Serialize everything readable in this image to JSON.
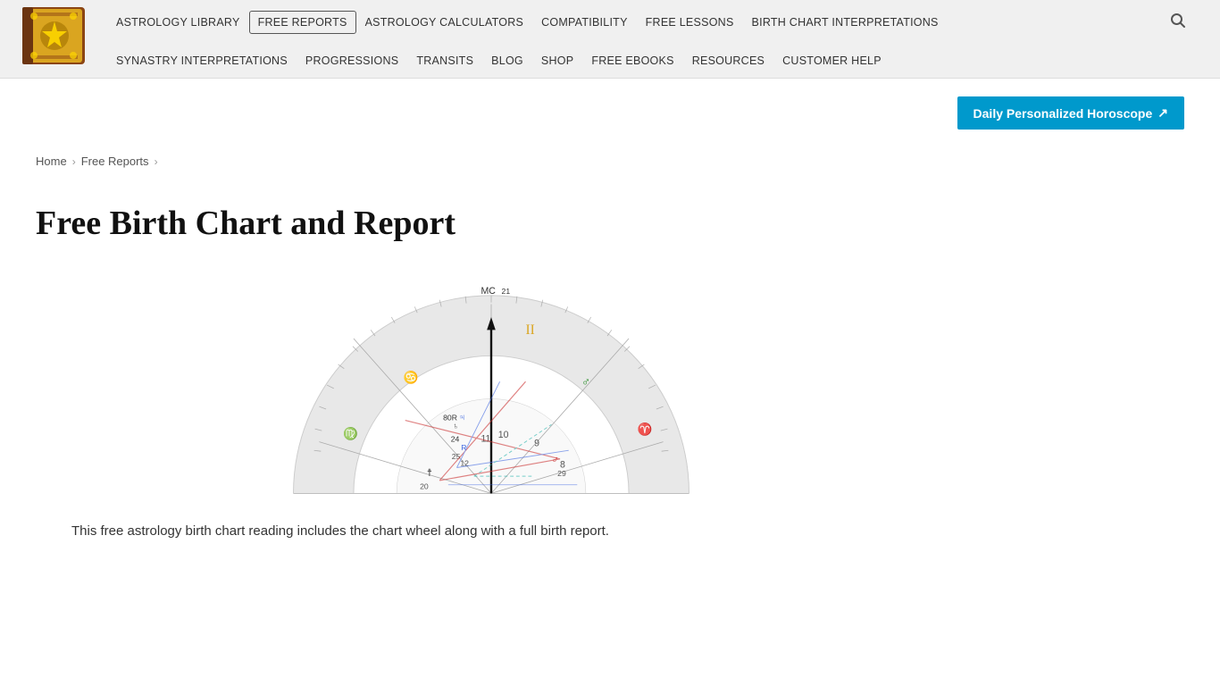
{
  "header": {
    "logo_alt": "Astrology Book Logo"
  },
  "nav": {
    "row1": [
      {
        "label": "ASTROLOGY LIBRARY",
        "active": false
      },
      {
        "label": "FREE REPORTS",
        "active": true
      },
      {
        "label": "ASTROLOGY CALCULATORS",
        "active": false
      },
      {
        "label": "COMPATIBILITY",
        "active": false
      },
      {
        "label": "FREE LESSONS",
        "active": false
      },
      {
        "label": "BIRTH CHART INTERPRETATIONS",
        "active": false
      }
    ],
    "row2": [
      {
        "label": "SYNASTRY INTERPRETATIONS",
        "active": false
      },
      {
        "label": "PROGRESSIONS",
        "active": false
      },
      {
        "label": "TRANSITS",
        "active": false
      },
      {
        "label": "BLOG",
        "active": false
      },
      {
        "label": "SHOP",
        "active": false
      },
      {
        "label": "FREE EBOOKS",
        "active": false
      },
      {
        "label": "RESOURCES",
        "active": false
      },
      {
        "label": "CUSTOMER HELP",
        "active": false
      }
    ]
  },
  "daily_horoscope": {
    "label": "Daily Personalized Horoscope",
    "arrow": "↗"
  },
  "breadcrumb": {
    "home": "Home",
    "free_reports": "Free Reports"
  },
  "page": {
    "title": "Free Birth Chart and Report",
    "description": "This free astrology birth chart reading includes the chart wheel along with a full birth report."
  }
}
